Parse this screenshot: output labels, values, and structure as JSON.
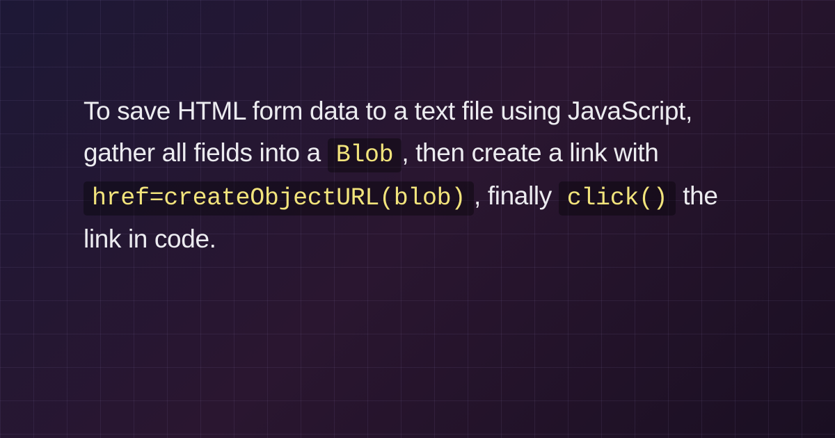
{
  "paragraph": {
    "segments": [
      {
        "type": "text",
        "value": "To save HTML form data to a text file using JavaScript, gather all fields into a "
      },
      {
        "type": "code",
        "value": "Blob"
      },
      {
        "type": "text",
        "value": ", then create a link with "
      },
      {
        "type": "code",
        "value": "href=createObjectURL(blob)"
      },
      {
        "type": "text",
        "value": ", finally "
      },
      {
        "type": "code",
        "value": "click()"
      },
      {
        "type": "text",
        "value": " the link in code."
      }
    ]
  }
}
